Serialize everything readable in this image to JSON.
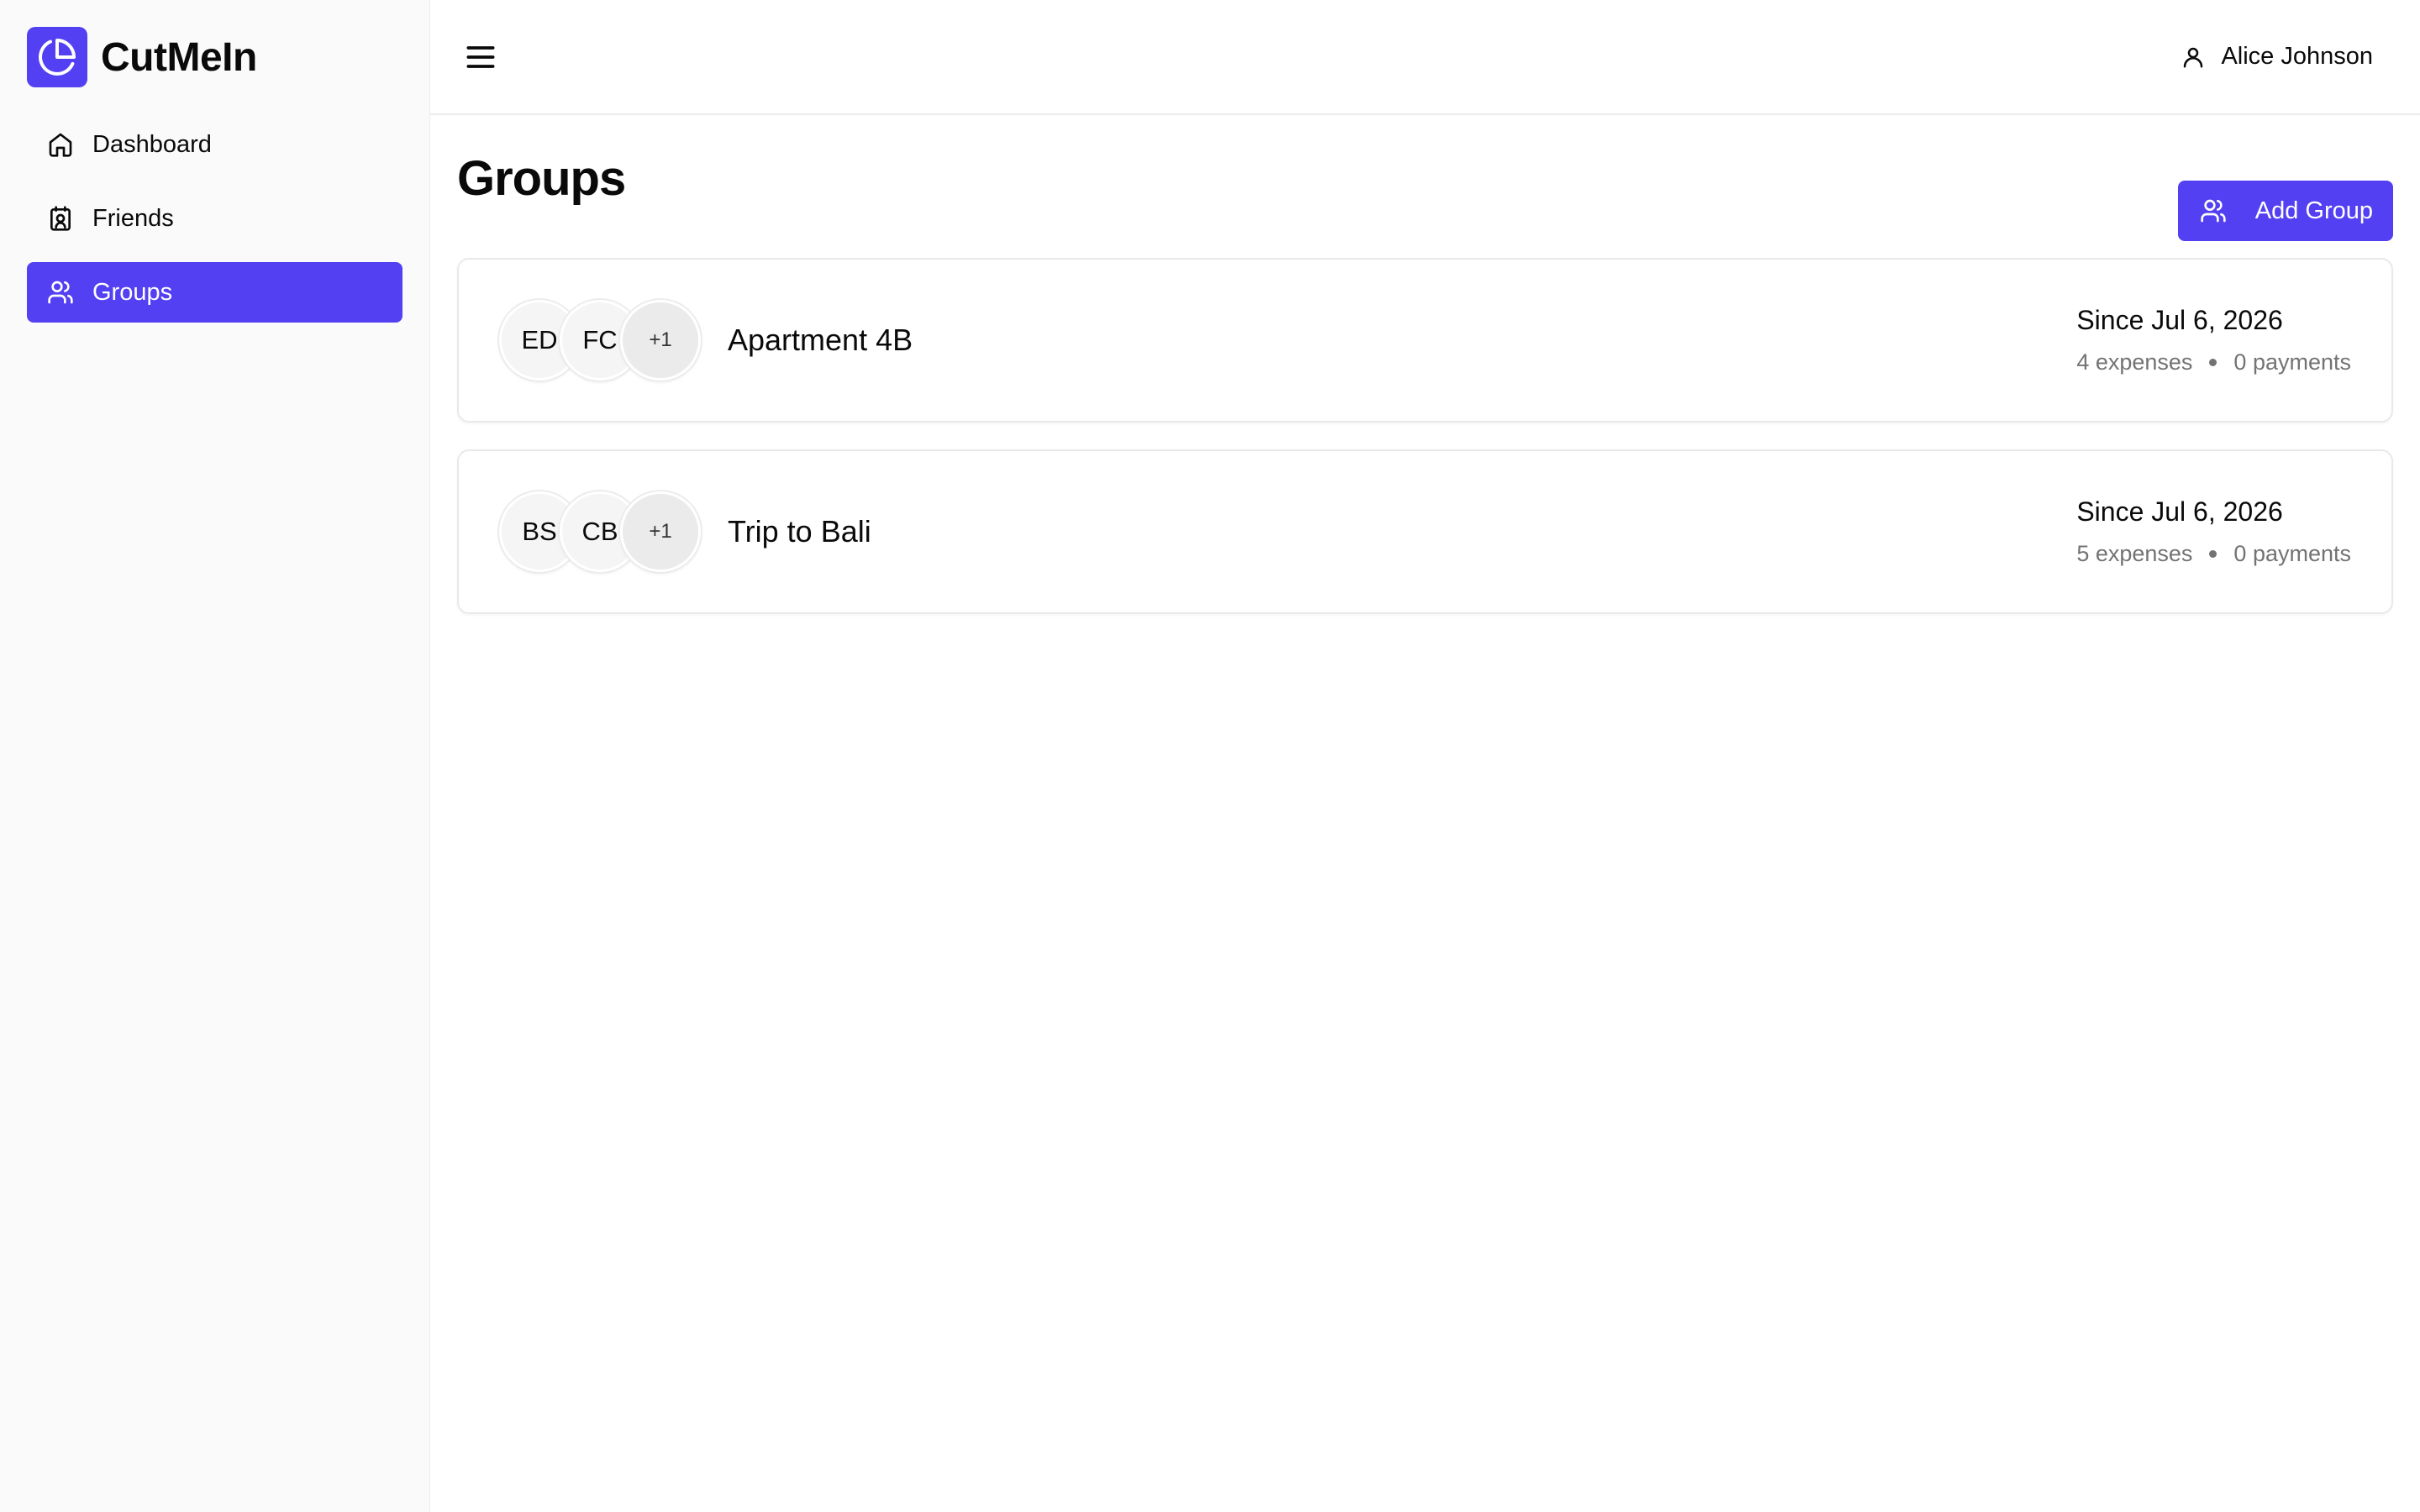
{
  "app": {
    "name": "CutMeIn"
  },
  "sidebar": {
    "items": [
      {
        "label": "Dashboard",
        "icon": "home-icon",
        "active": false
      },
      {
        "label": "Friends",
        "icon": "contact-card-icon",
        "active": false
      },
      {
        "label": "Groups",
        "icon": "users-icon",
        "active": true
      }
    ]
  },
  "header": {
    "user_name": "Alice Johnson"
  },
  "page": {
    "title": "Groups",
    "add_button": "Add Group"
  },
  "groups": [
    {
      "name": "Apartment 4B",
      "avatars": [
        "ED",
        "FC"
      ],
      "more": "+1",
      "since": "Since Jul 6, 2026",
      "expenses": "4 expenses",
      "payments": "0 payments"
    },
    {
      "name": "Trip to Bali",
      "avatars": [
        "BS",
        "CB"
      ],
      "more": "+1",
      "since": "Since Jul 6, 2026",
      "expenses": "5 expenses",
      "payments": "0 payments"
    }
  ],
  "colors": {
    "accent": "#5340f2",
    "sidebar_bg": "#fafafa",
    "muted_text": "#737373"
  }
}
